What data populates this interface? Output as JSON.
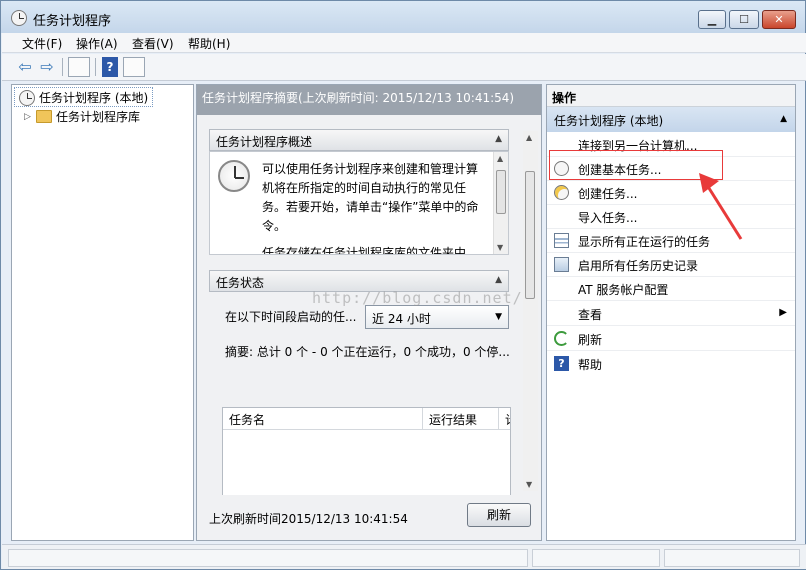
{
  "window": {
    "title": "任务计划程序"
  },
  "menu": {
    "items": [
      "文件(F)",
      "操作(A)",
      "查看(V)",
      "帮助(H)"
    ]
  },
  "toolbar": {
    "help_glyph": "?",
    "back_glyph": "⇦",
    "forward_glyph": "⇨"
  },
  "tree": {
    "root_label": "任务计划程序 (本地)",
    "child_label": "任务计划程序库",
    "expander": "▷"
  },
  "center": {
    "header": "任务计划程序摘要(上次刷新时间: 2015/12/13 10:41:54)",
    "overview_title": "任务计划程序概述",
    "overview_text": "可以使用任务计划程序来创建和管理计算机将在所指定的时间自动执行的常见任务。若要开始，请单击“操作”菜单中的命令。",
    "overview_text2": "任务存储在任务计划程序库的文件夹中",
    "status_title": "任务状态",
    "period_label": "在以下时间段启动的任...",
    "period_value": "近 24 小时",
    "summary": "摘要: 总计 0 个 - 0 个正在运行，0 个成功，0 个停...",
    "table_headers": [
      "任务名",
      "运行结果",
      "计"
    ],
    "footer_text": "上次刷新时间2015/12/13 10:41:54",
    "refresh_label": "刷新",
    "watermark": "http://blog.csdn.net/"
  },
  "actions": {
    "title": "操作",
    "group": "任务计划程序 (本地)",
    "items": [
      {
        "label": "连接到另一台计算机...",
        "icon": "none"
      },
      {
        "label": "创建基本任务...",
        "icon": "clock-icon"
      },
      {
        "label": "创建任务...",
        "icon": "new-task-icon"
      },
      {
        "label": "导入任务...",
        "icon": "none"
      },
      {
        "label": "显示所有正在运行的任务",
        "icon": "running-list-icon"
      },
      {
        "label": "启用所有任务历史记录",
        "icon": "history-icon"
      },
      {
        "label": "AT 服务帐户配置",
        "icon": "none"
      },
      {
        "label": "查看",
        "icon": "none"
      },
      {
        "label": "刷新",
        "icon": "refresh-icon"
      },
      {
        "label": "帮助",
        "icon": "help-icon"
      }
    ]
  },
  "colors": {
    "highlight": "#e83a3a",
    "header_gray": "#9ba3ad",
    "group_blue": "#c3d5ea"
  }
}
